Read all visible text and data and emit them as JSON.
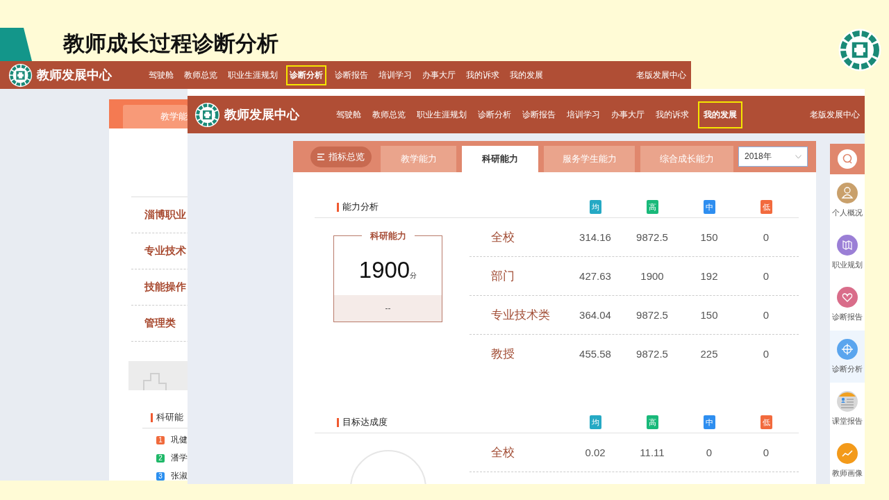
{
  "slide": {
    "title": "教师成长过程诊断分析"
  },
  "back_screen": {
    "brand": "教师发展中心",
    "nav": [
      {
        "label": "驾驶舱",
        "highlighted": false
      },
      {
        "label": "教师总览",
        "highlighted": false
      },
      {
        "label": "职业生涯规划",
        "highlighted": false
      },
      {
        "label": "诊断分析",
        "highlighted": true
      },
      {
        "label": "诊断报告",
        "highlighted": false
      },
      {
        "label": "培训学习",
        "highlighted": false
      },
      {
        "label": "办事大厅",
        "highlighted": false
      },
      {
        "label": "我的诉求",
        "highlighted": false
      },
      {
        "label": "我的发展",
        "highlighted": false
      }
    ],
    "old_version_link": "老版发展中心",
    "tab": "教学能",
    "categories": [
      "淄博职业",
      "专业技术",
      "技能操作",
      "管理类"
    ],
    "ranking": {
      "title": "科研能",
      "items": [
        {
          "rank": "1",
          "name": "巩健",
          "color": "#f06a3c"
        },
        {
          "rank": "2",
          "name": "潘学",
          "color": "#1fb868"
        },
        {
          "rank": "3",
          "name": "张淑",
          "color": "#2b8ff0"
        }
      ]
    }
  },
  "front_screen": {
    "brand": "教师发展中心",
    "nav": [
      {
        "label": "驾驶舱",
        "highlighted": false
      },
      {
        "label": "教师总览",
        "highlighted": false
      },
      {
        "label": "职业生涯规划",
        "highlighted": false
      },
      {
        "label": "诊断分析",
        "highlighted": false
      },
      {
        "label": "诊断报告",
        "highlighted": false
      },
      {
        "label": "培训学习",
        "highlighted": false
      },
      {
        "label": "办事大厅",
        "highlighted": false
      },
      {
        "label": "我的诉求",
        "highlighted": false
      },
      {
        "label": "我的发展",
        "highlighted": true
      }
    ],
    "old_version_link": "老版发展中心",
    "overview_button": "指标总览",
    "tabs": [
      {
        "label": "教学能力",
        "selected": false
      },
      {
        "label": "科研能力",
        "selected": true
      },
      {
        "label": "服务学生能力",
        "selected": false
      },
      {
        "label": "综合成长能力",
        "selected": false
      }
    ],
    "year_select": {
      "value": "2018年"
    },
    "sections": [
      {
        "title": "能力分析",
        "legend": [
          {
            "label": "均",
            "color": "#25a9c4"
          },
          {
            "label": "高",
            "color": "#19b97a"
          },
          {
            "label": "中",
            "color": "#2e8ef0"
          },
          {
            "label": "低",
            "color": "#f26a3d"
          }
        ],
        "score_card": {
          "title": "科研能力",
          "score": "1900",
          "unit": "分",
          "note": "--"
        },
        "rows": [
          {
            "name": "全校",
            "values": [
              "314.16",
              "9872.5",
              "150",
              "0"
            ]
          },
          {
            "name": "部门",
            "values": [
              "427.63",
              "1900",
              "192",
              "0"
            ]
          },
          {
            "name": "专业技术类",
            "values": [
              "364.04",
              "9872.5",
              "150",
              "0"
            ]
          },
          {
            "name": "教授",
            "values": [
              "455.58",
              "9872.5",
              "225",
              "0"
            ]
          }
        ]
      },
      {
        "title": "目标达成度",
        "legend": [
          {
            "label": "均",
            "color": "#25a9c4"
          },
          {
            "label": "高",
            "color": "#19b97a"
          },
          {
            "label": "中",
            "color": "#2e8ef0"
          },
          {
            "label": "低",
            "color": "#f26a3d"
          }
        ],
        "rows": [
          {
            "name": "全校",
            "values": [
              "0.02",
              "11.11",
              "0",
              "0"
            ]
          }
        ]
      }
    ],
    "side_menu": [
      {
        "kind": "search",
        "selected": false,
        "color": "#ffffff"
      },
      {
        "kind": "person",
        "label": "个人概况",
        "selected": false,
        "color": "#c9a06b"
      },
      {
        "kind": "map",
        "label": "职业规划",
        "selected": false,
        "color": "#9b7fd6"
      },
      {
        "kind": "heart",
        "label": "诊断报告",
        "selected": false,
        "color": "#d96d8a"
      },
      {
        "kind": "target",
        "label": "诊断分析",
        "selected": true,
        "color": "#5aa5ee"
      },
      {
        "kind": "report",
        "label": "课堂报告",
        "selected": false,
        "color": "#d8d8d8"
      },
      {
        "kind": "chart",
        "label": "教师画像",
        "selected": false,
        "color": "#f39a1a"
      }
    ]
  }
}
